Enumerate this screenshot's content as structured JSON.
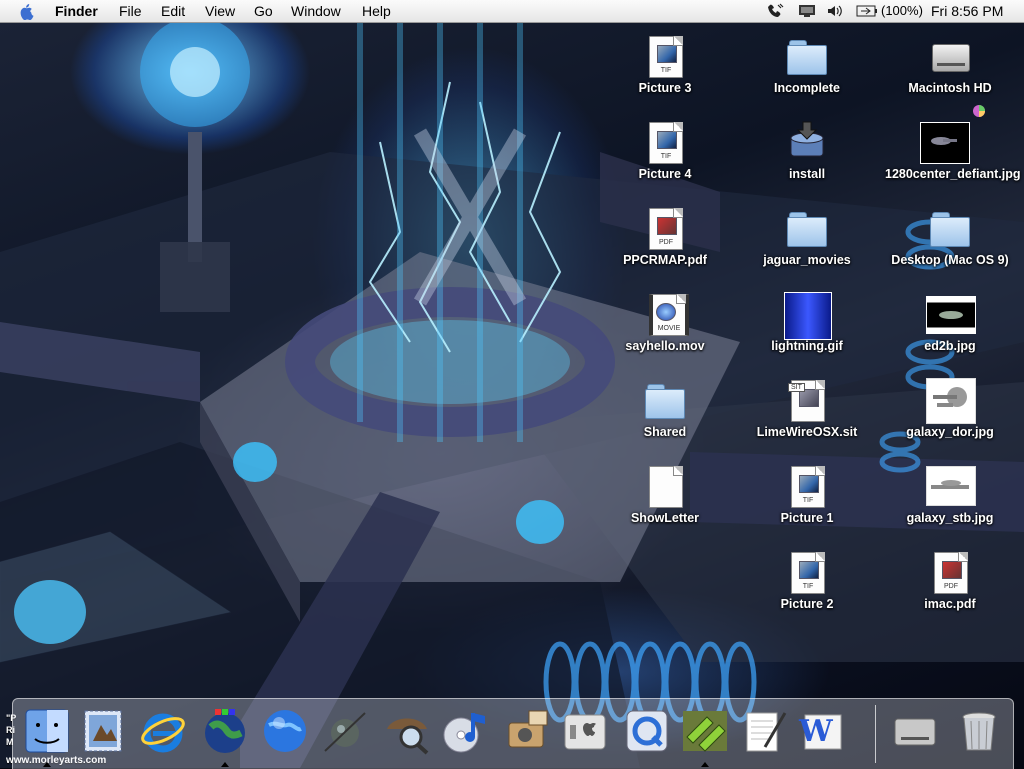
{
  "menubar": {
    "app_name": "Finder",
    "menus": [
      "File",
      "Edit",
      "View",
      "Go",
      "Window",
      "Help"
    ],
    "battery": "(100%)",
    "clock": "Fri 8:56 PM"
  },
  "desktop": {
    "icons": [
      {
        "label": "Picture 3",
        "kind": "tif-document",
        "tag": "TIF"
      },
      {
        "label": "Incomplete",
        "kind": "folder"
      },
      {
        "label": "Macintosh HD",
        "kind": "hard-disk"
      },
      {
        "label": "Picture 4",
        "kind": "tif-document",
        "tag": "TIF"
      },
      {
        "label": "install",
        "kind": "installer-package"
      },
      {
        "label": "1280center_defiant.jpg",
        "kind": "image-thumbnail"
      },
      {
        "label": "PPCRMAP.pdf",
        "kind": "pdf-document",
        "tag": "PDF"
      },
      {
        "label": "jaguar_movies",
        "kind": "folder"
      },
      {
        "label": "Desktop (Mac OS 9)",
        "kind": "folder"
      },
      {
        "label": "sayhello.mov",
        "kind": "movie-file",
        "tag": "MOVIE"
      },
      {
        "label": "lightning.gif",
        "kind": "image-thumbnail"
      },
      {
        "label": "ed2b.jpg",
        "kind": "image-thumbnail"
      },
      {
        "label": "Shared",
        "kind": "folder"
      },
      {
        "label": "LimeWireOSX.sit",
        "kind": "stuffit-archive",
        "tag": "SIT"
      },
      {
        "label": "galaxy_dor.jpg",
        "kind": "image-thumbnail"
      },
      {
        "label": "ShowLetter",
        "kind": "blank-document"
      },
      {
        "label": "Picture 1",
        "kind": "tif-document",
        "tag": "TIF"
      },
      {
        "label": "galaxy_stb.jpg",
        "kind": "image-thumbnail"
      },
      {
        "label": "Picture 2",
        "kind": "tif-document",
        "tag": "TIF"
      },
      {
        "label": "imac.pdf",
        "kind": "pdf-document",
        "tag": "PDF"
      }
    ]
  },
  "wallpaper_credit": {
    "lines": [
      "\"P",
      "Ri",
      "M"
    ],
    "url": "www.morleyarts.com"
  },
  "dock": {
    "items": [
      {
        "name": "finder",
        "icon": "finder-face-icon",
        "running": true
      },
      {
        "name": "mail",
        "icon": "mail-stamp-icon",
        "running": false
      },
      {
        "name": "internet-explorer",
        "icon": "internet-explorer-icon",
        "running": false
      },
      {
        "name": "system-preferences-globe",
        "icon": "globe-icon",
        "running": true
      },
      {
        "name": "network-globe",
        "icon": "blue-globe-icon",
        "running": false
      },
      {
        "name": "ichat",
        "icon": "satellite-icon",
        "running": false
      },
      {
        "name": "sherlock",
        "icon": "sherlock-hat-icon",
        "running": false
      },
      {
        "name": "itunes",
        "icon": "itunes-cd-icon",
        "running": false
      },
      {
        "name": "image-capture",
        "icon": "camera-icon",
        "running": false
      },
      {
        "name": "system-preferences",
        "icon": "switch-apple-icon",
        "running": false
      },
      {
        "name": "quicktime",
        "icon": "quicktime-icon",
        "running": false
      },
      {
        "name": "limewire",
        "icon": "limewire-icon",
        "running": true
      },
      {
        "name": "textedit",
        "icon": "textedit-pen-icon",
        "running": false
      },
      {
        "name": "word",
        "icon": "word-icon",
        "running": false
      },
      {
        "name": "macintosh-hd",
        "icon": "hard-disk-icon",
        "running": false
      },
      {
        "name": "trash",
        "icon": "trash-icon",
        "running": false
      }
    ]
  },
  "colors": {
    "menubar": "#eeeeee",
    "label_text": "#ffffff",
    "folder_blue": "#9ec4ea"
  }
}
